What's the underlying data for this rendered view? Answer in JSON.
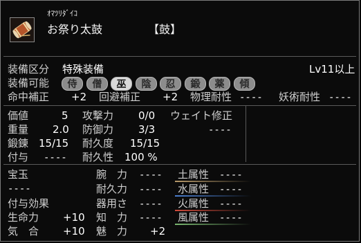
{
  "item": {
    "reading": "ｵﾏﾂﾘﾀﾞｲｺ",
    "name": "お祭り太鼓",
    "type": "【鼓】",
    "icon": "drum-icon"
  },
  "equip": {
    "category_label": "装備区分",
    "category_value": "特殊装備",
    "level": "Lv11以上",
    "possible_label": "装備可能",
    "classes": [
      "侍",
      "僧",
      "巫",
      "陰",
      "忍",
      "鍛",
      "薬",
      "傾"
    ],
    "active_classes": [
      "巫"
    ]
  },
  "corrections": {
    "hit_label": "命中補正",
    "hit_value": "+2",
    "evade_label": "回避補正",
    "evade_value": "+2",
    "phys_label": "物理耐性",
    "phys_value": "----",
    "magic_label": "妖術耐性",
    "magic_value": "----"
  },
  "stats": {
    "price_label": "価値",
    "price_value": "5",
    "weight_label": "重量",
    "weight_value": "2.0",
    "forge_label": "鍛錬",
    "forge_value": "15/15",
    "enchant_label": "付与",
    "enchant_value": "----",
    "attack_label": "攻撃力",
    "attack_value": "0/0",
    "defense_label": "防御力",
    "defense_value": "3/3",
    "durability_label": "耐久度",
    "durability_value": "15/15",
    "endurance_label": "耐久性",
    "endurance_value": "100 %",
    "weight_fix_label": "ウェイト修正",
    "weight_fix_value": "----"
  },
  "bottom": {
    "gem_label": "宝玉",
    "gem_value": "----",
    "effect_label": "付与効果",
    "life_label": "生命力",
    "life_value": "+10",
    "spirit_label": "気　合",
    "spirit_value": "+10",
    "arm_label": "腕　力",
    "arm_value": "----",
    "endure_label": "耐久力",
    "endure_value": "----",
    "dex_label": "器用さ",
    "dex_value": "----",
    "int_label": "知　力",
    "int_value": "----",
    "charm_label": "魅　力",
    "charm_value": "+2",
    "earth_label": "土属性",
    "earth_value": "----",
    "water_label": "水属性",
    "water_value": "----",
    "fire_label": "火属性",
    "fire_value": "----",
    "wind_label": "風属性",
    "wind_value": "----"
  },
  "colors": {
    "earth": "#b89a6a",
    "water": "#4a7ed0",
    "fire": "#d04a3a",
    "wind": "#7ab870"
  }
}
